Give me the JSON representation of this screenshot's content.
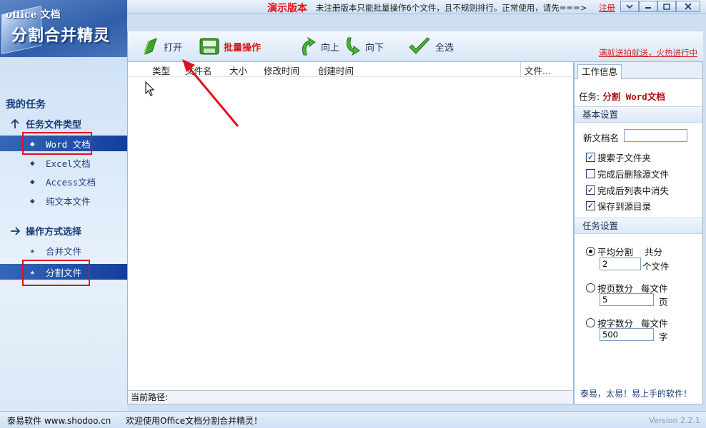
{
  "titlebar": {
    "demo_label": "演示版本",
    "demo_notice": "未注册版本只能批量操作6个文件，且不规则排行。正常使用，请先===>",
    "register_link": "注册"
  },
  "logo": {
    "small_text": "office 文档",
    "big_text": "分割合并精灵"
  },
  "sidebar": {
    "group_title": "我的任务",
    "section_types": "任务文件类型",
    "file_types": [
      "Word 文档",
      "Excel文档",
      "Access文档",
      "纯文本文件"
    ],
    "section_ops": "操作方式选择",
    "operations": [
      "合并文件",
      "分割文件"
    ]
  },
  "toolbar": {
    "open": "打开",
    "batch": "批量操作",
    "up": "向上",
    "down": "向下",
    "select_all": "全选",
    "promo": "满就送拍就送，火热进行中"
  },
  "filelist": {
    "columns": [
      "类型",
      "文件名",
      "大小",
      "修改时间",
      "创建时间",
      "文件..."
    ]
  },
  "pathbar": {
    "label": "当前路径:"
  },
  "rightpanel": {
    "tab": "工作信息",
    "task_label": "任务:",
    "task_value": "分割 Word文档",
    "basic_settings": "基本设置",
    "new_name_label": "新文档名",
    "new_name_value": "",
    "checks": [
      {
        "label": "搜索子文件夹",
        "checked": true
      },
      {
        "label": "完成后删除源文件",
        "checked": false
      },
      {
        "label": "完成后列表中消失",
        "checked": true
      },
      {
        "label": "保存到源目录",
        "checked": true
      }
    ],
    "task_settings": "任务设置",
    "split_avg": {
      "label": "平均分割",
      "prefix": "共分",
      "value": "2",
      "unit": "个文件",
      "selected": true
    },
    "split_pages": {
      "label": "按页数分",
      "prefix": "每文件",
      "value": "5",
      "unit": "页",
      "selected": false
    },
    "split_chars": {
      "label": "按字数分",
      "prefix": "每文件",
      "value": "500",
      "unit": "字",
      "selected": false
    },
    "slogan": "泰易，太易！易上手的软件！"
  },
  "statusbar": {
    "company": "泰易软件 www.shodoo.cn",
    "message": "欢迎使用Office文档分割合并精灵！",
    "version": "Version 2.2.1"
  },
  "colors": {
    "accent_red": "#e0101a",
    "nav_active": "#1a47a4",
    "panel_bg": "#cfe0f4"
  }
}
